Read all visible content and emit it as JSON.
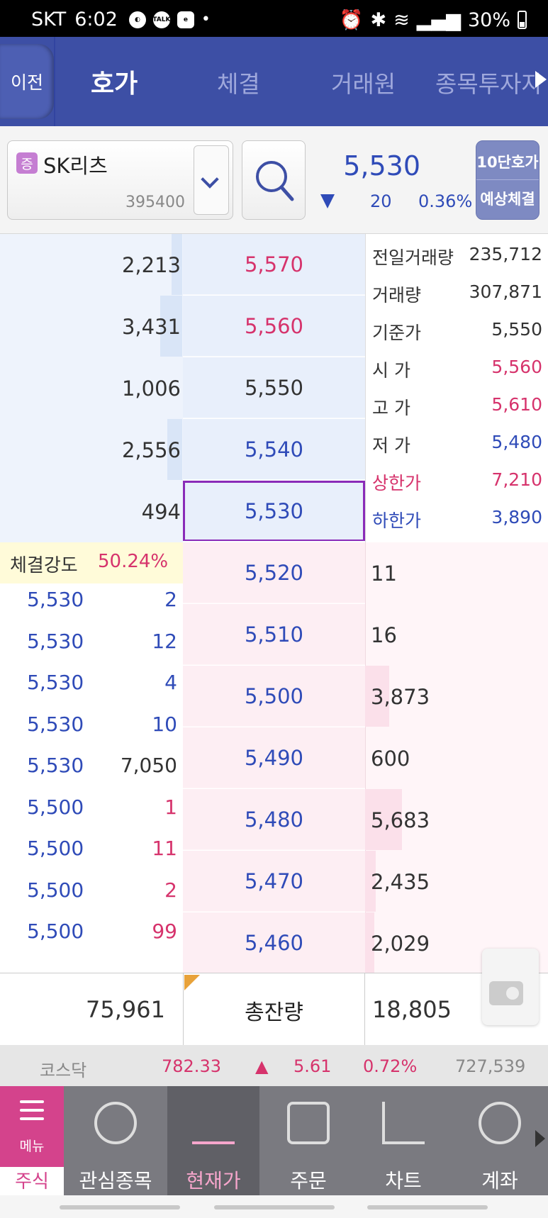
{
  "status": {
    "carrier": "SKT",
    "time": "6:02",
    "battery": "30%",
    "dot": "•",
    "icon_talk": "TALK"
  },
  "header": {
    "back_label": "이전",
    "tabs": [
      {
        "label": "호가"
      },
      {
        "label": "체결"
      },
      {
        "label": "거래원"
      },
      {
        "label": "종목투자자"
      }
    ]
  },
  "stock": {
    "badge": "증",
    "name": "SK리츠",
    "code": "395400",
    "price": "5,530",
    "change": "20",
    "change_pct": "0.36%"
  },
  "buttons": {
    "ten_level": "10단호가",
    "expected": "예상체결"
  },
  "asks": [
    {
      "qty": "2,213",
      "price": "5,570",
      "price_color": "#d6336c",
      "bar": 0.06
    },
    {
      "qty": "3,431",
      "price": "5,560",
      "price_color": "#d6336c",
      "bar": 0.12
    },
    {
      "qty": "1,006",
      "price": "5,550",
      "price_color": "#333333",
      "bar": 0.0
    },
    {
      "qty": "2,556",
      "price": "5,540",
      "price_color": "#2f4bb8",
      "bar": 0.08
    },
    {
      "qty": "494",
      "price": "5,530",
      "price_color": "#2f4bb8",
      "bar": 0.0
    }
  ],
  "info": [
    {
      "key": "전일거래량",
      "value": "235,712",
      "key_color": "#333333",
      "value_color": "#333333"
    },
    {
      "key": "거래량",
      "value": "307,871",
      "key_color": "#333333",
      "value_color": "#333333"
    },
    {
      "key": "기준가",
      "value": "5,550",
      "key_color": "#333333",
      "value_color": "#333333"
    },
    {
      "key": "시  가",
      "value": "5,560",
      "key_color": "#333333",
      "value_color": "#d6336c"
    },
    {
      "key": "고  가",
      "value": "5,610",
      "key_color": "#333333",
      "value_color": "#d6336c"
    },
    {
      "key": "저  가",
      "value": "5,480",
      "key_color": "#333333",
      "value_color": "#2f4bb8"
    },
    {
      "key": "상한가",
      "value": "7,210",
      "key_color": "#d6336c",
      "value_color": "#d6336c"
    },
    {
      "key": "하한가",
      "value": "3,890",
      "key_color": "#2f4bb8",
      "value_color": "#2f4bb8"
    }
  ],
  "strength": {
    "label": "체결강도",
    "value": "50.24%"
  },
  "trades": [
    {
      "price": "5,530",
      "qty": "2",
      "qty_color": "#2f4bb8"
    },
    {
      "price": "5,530",
      "qty": "12",
      "qty_color": "#2f4bb8"
    },
    {
      "price": "5,530",
      "qty": "4",
      "qty_color": "#2f4bb8"
    },
    {
      "price": "5,530",
      "qty": "10",
      "qty_color": "#2f4bb8"
    },
    {
      "price": "5,530",
      "qty": "7,050",
      "qty_color": "#333333"
    },
    {
      "price": "5,500",
      "qty": "1",
      "qty_color": "#d6336c"
    },
    {
      "price": "5,500",
      "qty": "11",
      "qty_color": "#d6336c"
    },
    {
      "price": "5,500",
      "qty": "2",
      "qty_color": "#d6336c"
    },
    {
      "price": "5,500",
      "qty": "99",
      "qty_color": "#d6336c"
    }
  ],
  "bids": [
    {
      "price": "5,520",
      "qty": "11",
      "bar": 0.0
    },
    {
      "price": "5,510",
      "qty": "16",
      "bar": 0.0
    },
    {
      "price": "5,500",
      "qty": "3,873",
      "bar": 0.13
    },
    {
      "price": "5,490",
      "qty": "600",
      "bar": 0.0
    },
    {
      "price": "5,480",
      "qty": "5,683",
      "bar": 0.2
    },
    {
      "price": "5,470",
      "qty": "2,435",
      "bar": 0.06
    },
    {
      "price": "5,460",
      "qty": "2,029",
      "bar": 0.05
    }
  ],
  "totals": {
    "ask_total": "75,961",
    "label": "총잔량",
    "bid_total": "18,805"
  },
  "index": {
    "name": "코스닥",
    "value": "782.33",
    "arrow": "▲",
    "change": "5.61",
    "pct": "0.72%",
    "volume": "727,539"
  },
  "nav": {
    "menu_label": "메뉴",
    "stock_label": "주식",
    "items": [
      {
        "label": "관심종목"
      },
      {
        "label": "현재가"
      },
      {
        "label": "주문"
      },
      {
        "label": "차트"
      },
      {
        "label": "계좌"
      }
    ]
  },
  "colors": {
    "header": "#3d4fa5",
    "up": "#d6336c",
    "down": "#2f4bb8",
    "menu": "#d4438c"
  }
}
